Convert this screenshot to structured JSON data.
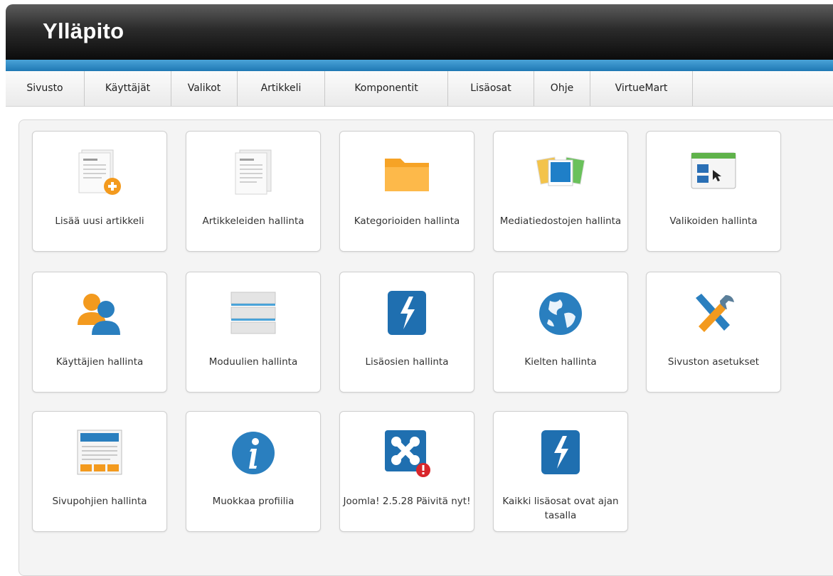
{
  "header": {
    "title": "Ylläpito"
  },
  "menu": [
    {
      "label": "Sivusto"
    },
    {
      "label": "Käyttäjät"
    },
    {
      "label": "Valikot"
    },
    {
      "label": "Artikkeli"
    },
    {
      "label": "Komponentit"
    },
    {
      "label": "Lisäosat"
    },
    {
      "label": "Ohje"
    },
    {
      "label": "VirtueMart"
    }
  ],
  "tiles": [
    {
      "label": "Lisää uusi artikkeli",
      "icon": "add-article-icon"
    },
    {
      "label": "Artikkeleiden hallinta",
      "icon": "article-icon"
    },
    {
      "label": "Kategorioiden hallinta",
      "icon": "folder-icon"
    },
    {
      "label": "Mediatiedostojen hallinta",
      "icon": "media-icon"
    },
    {
      "label": "Valikoiden hallinta",
      "icon": "menu-manager-icon"
    },
    {
      "label": "Käyttäjien hallinta",
      "icon": "users-icon"
    },
    {
      "label": "Moduulien hallinta",
      "icon": "modules-icon"
    },
    {
      "label": "Lisäosien hallinta",
      "icon": "extensions-icon"
    },
    {
      "label": "Kielten hallinta",
      "icon": "globe-icon"
    },
    {
      "label": "Sivuston asetukset",
      "icon": "tools-icon"
    },
    {
      "label": "Sivupohjien hallinta",
      "icon": "template-icon"
    },
    {
      "label": "Muokkaa profiilia",
      "icon": "info-icon"
    },
    {
      "label": "Joomla! 2.5.28 Päivitä nyt!",
      "icon": "joomla-update-icon"
    },
    {
      "label": "Kaikki lisäosat ovat ajan tasalla",
      "icon": "extensions-uptodate-icon"
    }
  ]
}
